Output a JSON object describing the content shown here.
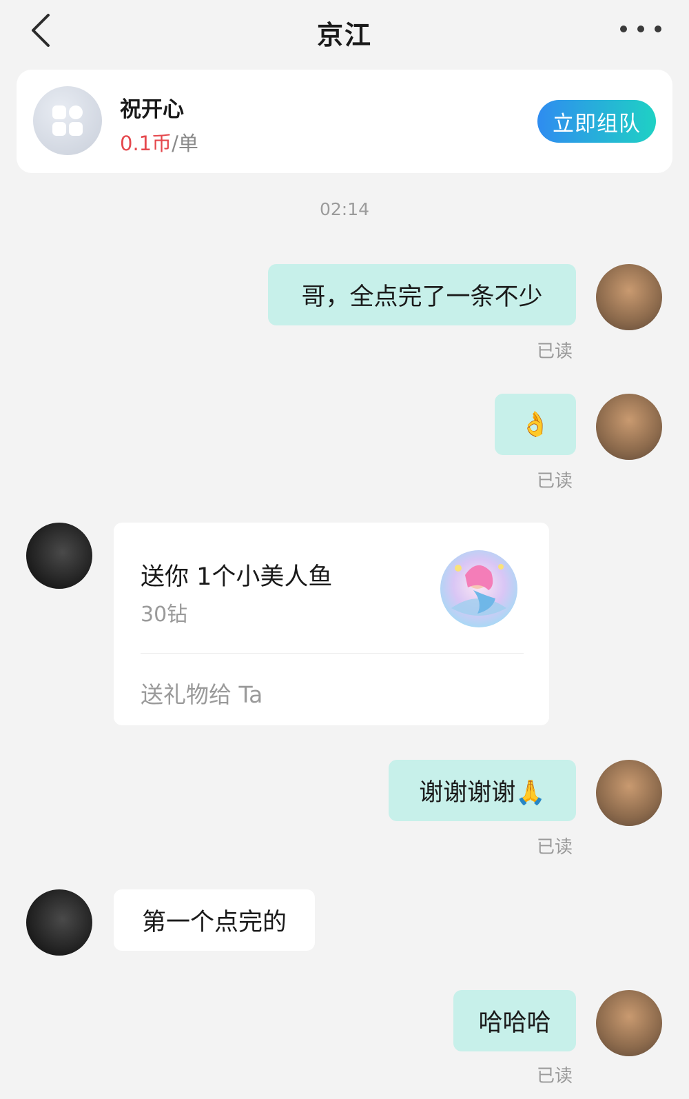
{
  "header": {
    "title": "京江",
    "back_icon": "chevron-left-icon",
    "more_icon": "more-icon"
  },
  "service_card": {
    "icon": "apps-icon",
    "name": "祝开心",
    "price": "0.1币",
    "unit": "/单",
    "button_label": "立即组队",
    "button_colors": [
      "#2f8cf0",
      "#1fd1c4"
    ]
  },
  "timestamp": "02:14",
  "messages": [
    {
      "from": "me",
      "text": "哥，全点完了一条不少",
      "status": "已读"
    },
    {
      "from": "me",
      "text": "👌",
      "status": "已读"
    },
    {
      "from": "them",
      "type": "gift",
      "title": "送你 1个小美人鱼",
      "price": "30钻",
      "action": "送礼物给 Ta",
      "image": "mermaid-gift-icon"
    },
    {
      "from": "me",
      "text": "谢谢谢谢🙏",
      "status": "已读"
    },
    {
      "from": "them",
      "text": "第一个点完的"
    },
    {
      "from": "me",
      "text": "哈哈哈",
      "status": "已读"
    }
  ],
  "colors": {
    "my_bubble": "#c7f0ea",
    "their_bubble": "#ffffff",
    "background": "#f3f3f3",
    "price": "#e5484d"
  }
}
